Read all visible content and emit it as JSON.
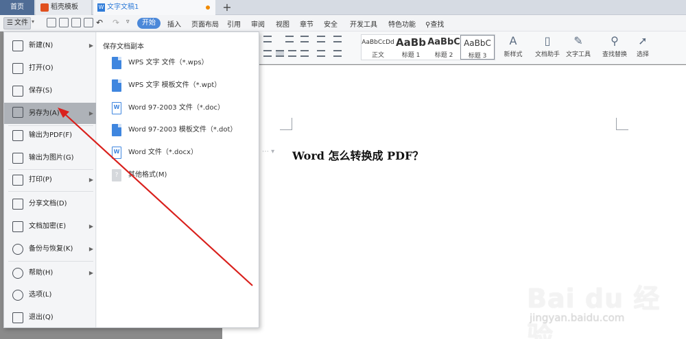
{
  "tabs": {
    "home": "首页",
    "template": "稻壳模板",
    "document": "文字文稿1",
    "add": "+"
  },
  "toolbar": {
    "file_label": "文件",
    "menus": [
      "开始",
      "插入",
      "页面布局",
      "引用",
      "审阅",
      "视图",
      "章节",
      "安全",
      "开发工具",
      "特色功能",
      "查找"
    ]
  },
  "ribbon": {
    "styles": [
      {
        "sample": "AaBbCcDd",
        "name": "正文"
      },
      {
        "sample": "AaBb",
        "name": "标题 1"
      },
      {
        "sample": "AaBbC",
        "name": "标题 2"
      },
      {
        "sample": "AaBbC",
        "name": "标题 3"
      }
    ],
    "new_style": "新样式",
    "doc_assistant": "文档助手",
    "text_tools": "文字工具",
    "find_replace": "查找替换",
    "select": "选择"
  },
  "file_menu": {
    "items": [
      {
        "label": "新建(N)",
        "submenu": true
      },
      {
        "label": "打开(O)",
        "submenu": false
      },
      {
        "label": "保存(S)",
        "submenu": false
      },
      {
        "label": "另存为(A)",
        "submenu": true,
        "active": true
      },
      {
        "label": "输出为PDF(F)",
        "submenu": false
      },
      {
        "label": "输出为图片(G)",
        "submenu": false
      },
      {
        "label": "打印(P)",
        "submenu": true
      },
      {
        "label": "分享文档(D)",
        "submenu": false
      },
      {
        "label": "文档加密(E)",
        "submenu": true
      },
      {
        "label": "备份与恢复(K)",
        "submenu": true
      },
      {
        "label": "帮助(H)",
        "submenu": true
      },
      {
        "label": "选项(L)",
        "submenu": false
      },
      {
        "label": "退出(Q)",
        "submenu": false
      }
    ],
    "save_copy_title": "保存文档副本",
    "formats": [
      {
        "label": "WPS 文字 文件（*.wps）",
        "icon": "wps-doc-icon"
      },
      {
        "label": "WPS 文字 模板文件（*.wpt）",
        "icon": "wps-template-icon"
      },
      {
        "label": "Word 97-2003 文件（*.doc）",
        "icon": "word-doc-icon"
      },
      {
        "label": "Word 97-2003 模板文件（*.dot）",
        "icon": "word-template-icon"
      },
      {
        "label": "Word 文件（*.docx）",
        "icon": "docx-icon"
      },
      {
        "label": "其他格式(M)",
        "icon": "other-format-icon"
      }
    ]
  },
  "document": {
    "heading": "Word 怎么转换成 PDF？"
  },
  "watermark": {
    "logo": "Bai du 经验",
    "url": "jingyan.baidu.com"
  },
  "colors": {
    "accent": "#4b88d9",
    "annotation_arrow": "#d9201c",
    "active_tab_text": "#2f7bd8"
  }
}
